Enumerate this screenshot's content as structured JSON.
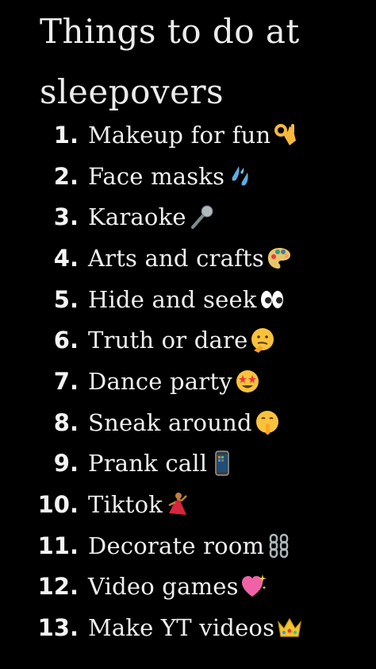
{
  "title": "Things to do at\nsleepovers",
  "items": [
    {
      "number": "1.",
      "label": "Makeup for fun",
      "icon": "ok-hand-icon"
    },
    {
      "number": "2.",
      "label": "Face masks",
      "icon": "sweat-droplets-icon"
    },
    {
      "number": "3.",
      "label": "Karaoke",
      "icon": "microphone-icon"
    },
    {
      "number": "4.",
      "label": "Arts and crafts",
      "icon": "artist-palette-icon"
    },
    {
      "number": "5.",
      "label": "Hide and seek",
      "icon": "eyes-icon"
    },
    {
      "number": "6.",
      "label": "Truth or dare",
      "icon": "thinking-face-icon"
    },
    {
      "number": "7.",
      "label": "Dance party",
      "icon": "star-struck-face-icon"
    },
    {
      "number": "8.",
      "label": "Sneak around",
      "icon": "shushing-face-icon"
    },
    {
      "number": "9.",
      "label": "Prank call",
      "icon": "mobile-phone-icon"
    },
    {
      "number": "10.",
      "label": "Tiktok",
      "icon": "dancer-icon"
    },
    {
      "number": "11.",
      "label": "Decorate room",
      "icon": "chains-icon"
    },
    {
      "number": "12.",
      "label": "Video games",
      "icon": "sparkling-heart-icon"
    },
    {
      "number": "13.",
      "label": "Make YT videos",
      "icon": "crown-icon"
    }
  ]
}
